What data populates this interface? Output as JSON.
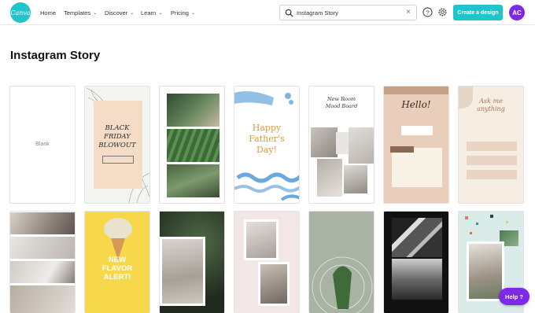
{
  "header": {
    "logo_text": "Canva",
    "nav": [
      {
        "label": "Home",
        "has_menu": false
      },
      {
        "label": "Templates",
        "has_menu": true
      },
      {
        "label": "Discover",
        "has_menu": true
      },
      {
        "label": "Learn",
        "has_menu": true
      },
      {
        "label": "Pricing",
        "has_menu": true
      }
    ],
    "search_value": "Instagram Story",
    "create_label": "Create a design",
    "avatar_initials": "AC",
    "accent_color": "#20c4cb",
    "avatar_color": "#7d2ae8"
  },
  "page": {
    "title": "Instagram Story"
  },
  "templates": {
    "blank_label": "Blank",
    "t2_title": "BLACK FRIDAY BLOWOUT",
    "t4_title": "Happy Father's Day!",
    "t5_title": "New Room Mood Board",
    "t6_title": "Hello!",
    "t7_title": "Ask me anything",
    "t9_title": "NEW FLAVOR ALERT!"
  },
  "help": {
    "label": "Help ?"
  }
}
